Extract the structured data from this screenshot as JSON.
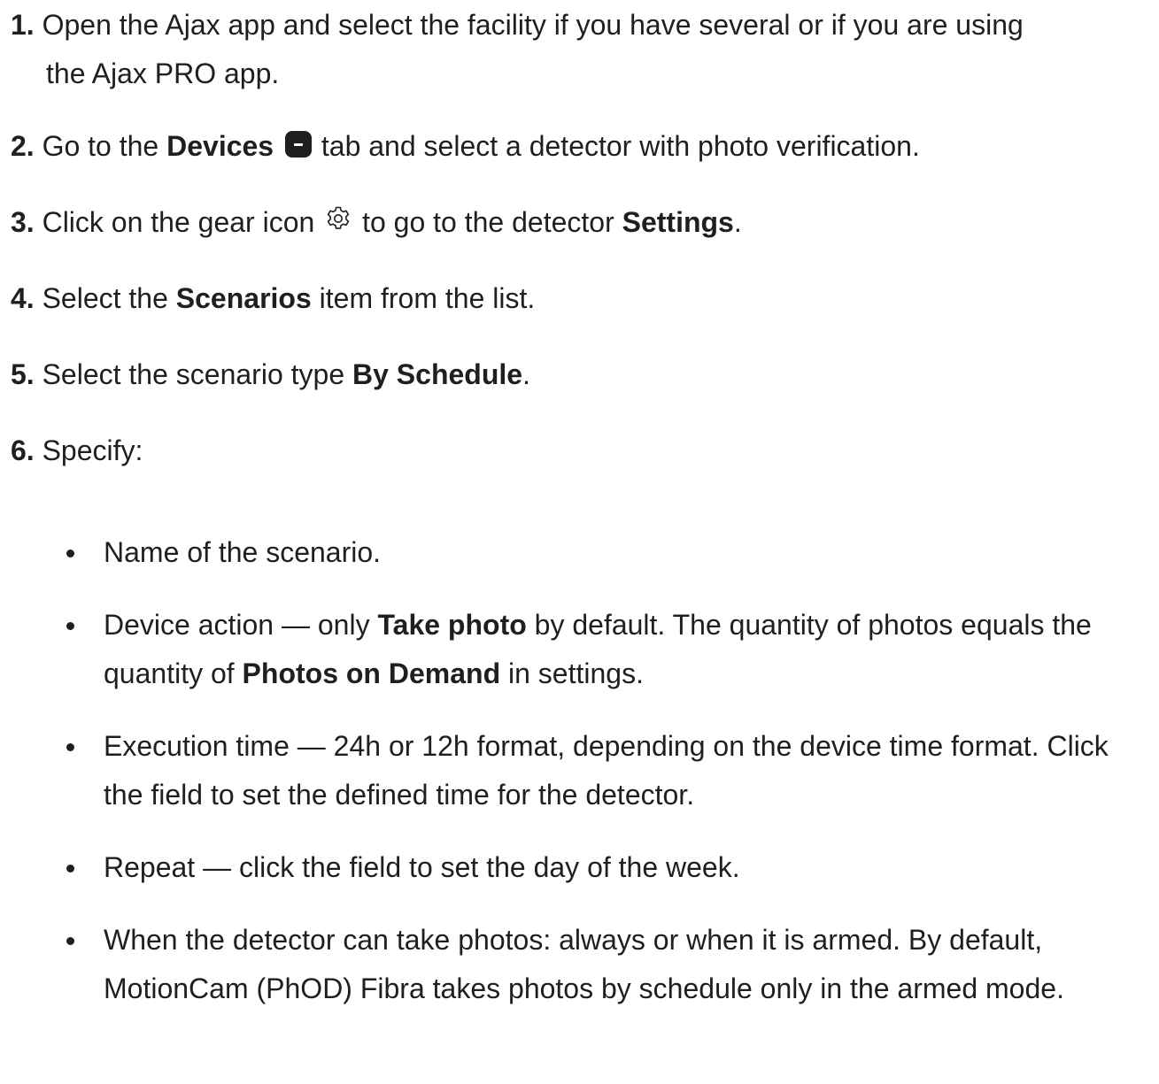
{
  "steps": [
    {
      "num": "1.",
      "text_a": "Open the Ajax app and select the facility if you have several or if you are using",
      "text_b": "the Ajax PRO app."
    },
    {
      "num": "2.",
      "pre": "Go to the",
      "bold": "Devices",
      "post": "tab and select a detector with photo verification.",
      "icon": "devices-tab-icon"
    },
    {
      "num": "3.",
      "pre": "Click on the gear icon",
      "mid": "to go to the detector",
      "bold": "Settings",
      "post": ".",
      "icon": "gear-icon"
    },
    {
      "num": "4.",
      "pre": "Select the",
      "bold": "Scenarios",
      "post": "item from the list."
    },
    {
      "num": "5.",
      "pre": "Select the scenario type",
      "bold": "By Schedule",
      "post": "."
    },
    {
      "num": "6.",
      "pre": "Specify:"
    }
  ],
  "bullets": [
    {
      "text": "Name of the scenario."
    },
    {
      "pre": "Device action — only",
      "bold1": "Take photo",
      "mid": "by default. The quantity of photos equals the quantity of",
      "bold2": "Photos on Demand",
      "post": "in settings."
    },
    {
      "line1": "Execution time — 24h or 12h format, depending on the device time format.",
      "line2": "Click the field to set the defined time for the detector."
    },
    {
      "text": "Repeat — click the field to set the day of the week."
    },
    {
      "line1": "When the detector can take photos: always or when it is armed. By default,",
      "line2": "MotionCam (PhOD) Fibra takes photos by schedule only in the armed",
      "line3": "mode."
    }
  ]
}
